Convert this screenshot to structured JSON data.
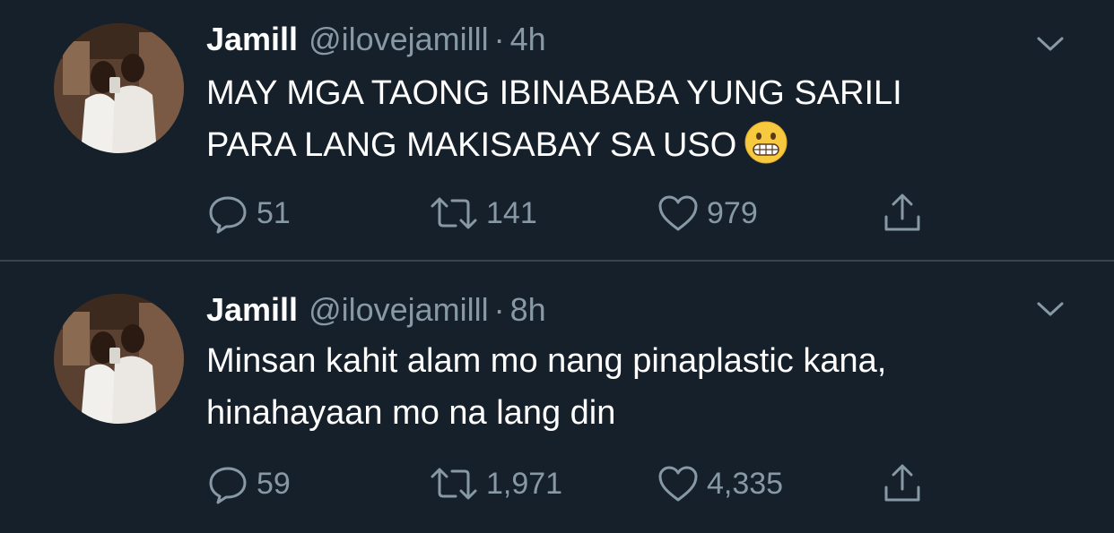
{
  "colors": {
    "background": "#15202b",
    "divider": "#38444d",
    "primary_text": "#ffffff",
    "secondary_text": "#8899a6"
  },
  "tweets": [
    {
      "author_name": "Jamill",
      "handle": "@ilovejamilll",
      "separator": "·",
      "time": "4h",
      "text": "MAY MGA TAONG IBINABABA YUNG SARILI\nPARA LANG MAKISABAY SA USO",
      "emoji": "grimacing-face-emoji",
      "replies": "51",
      "retweets": "141",
      "likes": "979"
    },
    {
      "author_name": "Jamill",
      "handle": "@ilovejamilll",
      "separator": "·",
      "time": "8h",
      "text": "Minsan kahit alam mo nang pinaplastic kana,\nhinahayaan mo na lang din",
      "emoji": null,
      "replies": "59",
      "retweets": "1,971",
      "likes": "4,335"
    }
  ],
  "icons": {
    "reply": "speech-bubble-icon",
    "retweet": "retweet-arrows-icon",
    "like": "heart-icon",
    "share": "share-upload-icon",
    "menu": "chevron-down-icon"
  }
}
